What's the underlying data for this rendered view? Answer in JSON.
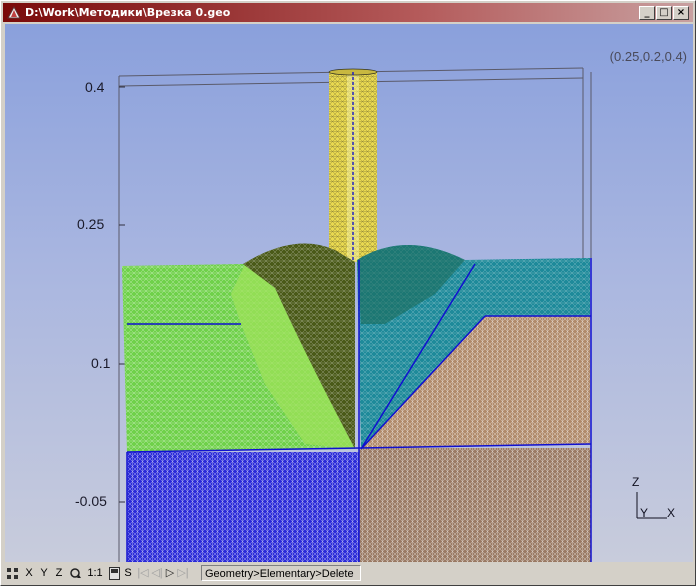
{
  "window": {
    "title": "D:\\Work\\Методики\\Врезка 0.geo",
    "minimize_glyph": "_",
    "maximize_glyph": "□",
    "close_glyph": "×"
  },
  "viewport": {
    "coordinates": "(0.25,0.2,0.4)",
    "z_ticks": [
      "0.4",
      "0.25",
      "0.1",
      "-0.05"
    ],
    "axes": {
      "z": "Z",
      "y": "Y",
      "x": "X"
    }
  },
  "statusbar": {
    "buttons": [
      {
        "label": "X",
        "name": "view-x-button"
      },
      {
        "label": "Y",
        "name": "view-y-button"
      },
      {
        "label": "Z",
        "name": "view-z-button"
      },
      {
        "label": "1:1",
        "name": "scale-1to1-button"
      },
      {
        "label": "S",
        "name": "s-button"
      }
    ],
    "message": "Geometry>Elementary>Delete"
  },
  "colors": {
    "title_bar": "#7a0a0a",
    "viewport_top": "#8aa0dc",
    "mesh_green": "#6fd14a",
    "mesh_olive": "#4a5a18",
    "mesh_teal": "#1e8a9a",
    "mesh_blue": "#2a2ad8",
    "mesh_copper": "#b08a6a",
    "pipe_yellow": "#e8d850"
  }
}
